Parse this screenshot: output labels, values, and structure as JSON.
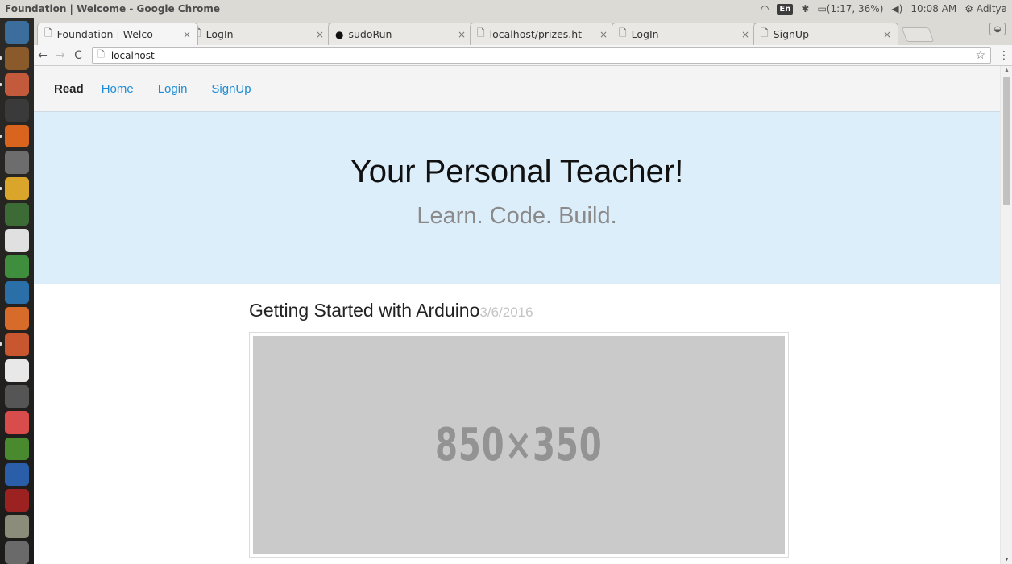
{
  "os": {
    "window_title": "Foundation | Welcome - Google Chrome",
    "keyboard": "En",
    "battery": "(1:17, 36%)",
    "time": "10:08 AM",
    "user": "Aditya"
  },
  "launcher": {
    "items": [
      {
        "name": "dash-home",
        "color": "#3b6e9c"
      },
      {
        "name": "sublime-text",
        "color": "#8a5a2b"
      },
      {
        "name": "files",
        "color": "#c45a3c"
      },
      {
        "name": "terminal",
        "color": "#3a3a3a"
      },
      {
        "name": "firefox",
        "color": "#d9641e"
      },
      {
        "name": "text-editor",
        "color": "#6d6d6d"
      },
      {
        "name": "chrome",
        "color": "#d9a52b"
      },
      {
        "name": "vim",
        "color": "#3d6b35"
      },
      {
        "name": "document",
        "color": "#e0e0e0"
      },
      {
        "name": "libreoffice-calc",
        "color": "#3e8e3e"
      },
      {
        "name": "libreoffice-impress",
        "color": "#2a6fa8"
      },
      {
        "name": "software-center",
        "color": "#d76b2a"
      },
      {
        "name": "libreoffice-writer",
        "color": "#c8562e"
      },
      {
        "name": "amazon",
        "color": "#e8e8e8"
      },
      {
        "name": "system-settings",
        "color": "#555555"
      },
      {
        "name": "disk-app",
        "color": "#d94c4c"
      },
      {
        "name": "battery-app",
        "color": "#4a8a2f"
      },
      {
        "name": "bluetooth",
        "color": "#2a5ea8"
      },
      {
        "name": "monitor-app",
        "color": "#9c2222"
      },
      {
        "name": "drive",
        "color": "#8c8c7a"
      },
      {
        "name": "trash",
        "color": "#6a6a6a"
      }
    ]
  },
  "browser": {
    "tabs": [
      {
        "label": "Foundation | Welco",
        "active": true,
        "icon": "page"
      },
      {
        "label": "LogIn",
        "active": false,
        "icon": "page"
      },
      {
        "label": "sudoRun",
        "active": false,
        "icon": "github"
      },
      {
        "label": "localhost/prizes.ht",
        "active": false,
        "icon": "page"
      },
      {
        "label": "LogIn",
        "active": false,
        "icon": "page"
      },
      {
        "label": "SignUp",
        "active": false,
        "icon": "page"
      }
    ],
    "url": "localhost"
  },
  "page": {
    "nav": {
      "brand": "Read",
      "links": [
        "Home",
        "Login",
        "SignUp"
      ]
    },
    "hero": {
      "title": "Your Personal Teacher!",
      "subtitle": "Learn. Code. Build."
    },
    "post": {
      "title": "Getting Started with Arduino",
      "date": "3/6/2016",
      "image_placeholder": "850×350"
    }
  },
  "colors": {
    "link": "#1f8dd6",
    "hero_bg": "#ddeefb",
    "placeholder_bg": "#cacaca"
  }
}
